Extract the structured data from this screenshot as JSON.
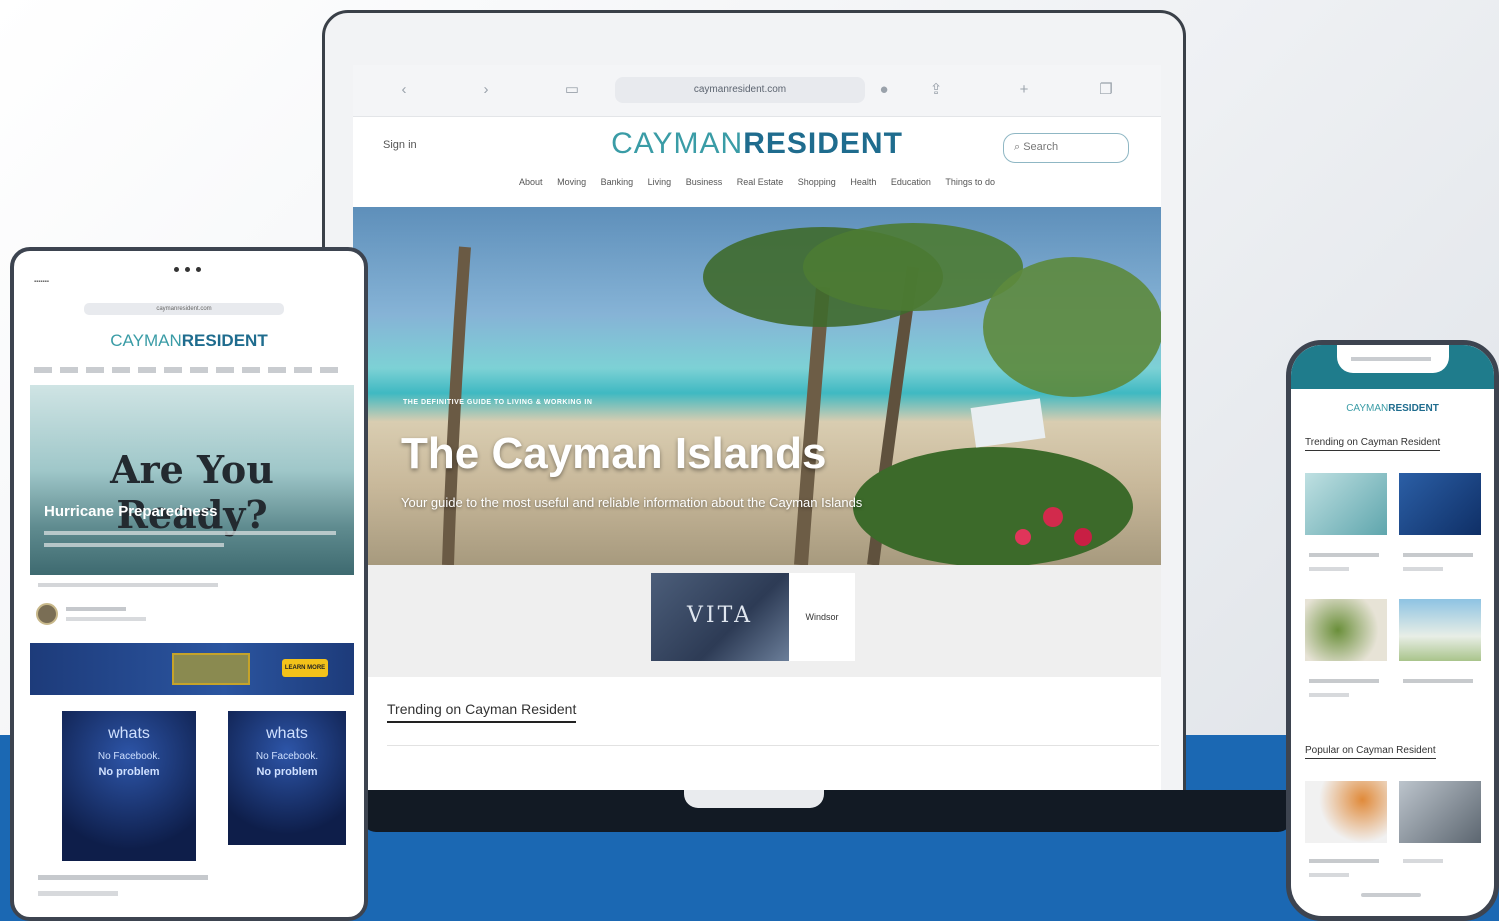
{
  "laptop": {
    "url": "caymanresident.com",
    "site": {
      "sign_in": "Sign in",
      "logo_light": "CAYMAN",
      "logo_bold": "RESIDENT",
      "search_placeholder": "Search"
    },
    "nav": [
      "About",
      "Moving",
      "Banking",
      "Living",
      "Business",
      "Real Estate",
      "Shopping",
      "Health",
      "Education",
      "Things to do"
    ],
    "hero": {
      "kicker": "THE DEFINITIVE GUIDE TO LIVING & WORKING IN",
      "title": "The Cayman Islands",
      "description": "Your guide to the most useful and reliable information about the Cayman Islands"
    },
    "ad": {
      "image_text": "VITA",
      "card_text": "Windsor"
    },
    "trending_title": "Trending on Cayman Resident"
  },
  "tablet": {
    "logo_light": "CAYMAN",
    "logo_bold": "RESIDENT",
    "hero_title": "Are You Ready?",
    "hero_subtitle": "Hurricane Preparedness",
    "banner_button": "LEARN MORE",
    "cards": [
      {
        "line1": "whats",
        "line2": "No Facebook.",
        "line3": "No problem"
      },
      {
        "line1": "whats",
        "line2": "No Facebook.",
        "line3": "No problem"
      }
    ]
  },
  "phone": {
    "logo_light": "CAYMAN",
    "logo_bold": "RESIDENT",
    "section1": "Trending on Cayman Resident",
    "section2": "Popular on Cayman Resident"
  },
  "colors": {
    "brand_teal": "#3a9ca6",
    "brand_dark": "#1f6c8e",
    "background_blue": "#1b68b3"
  }
}
